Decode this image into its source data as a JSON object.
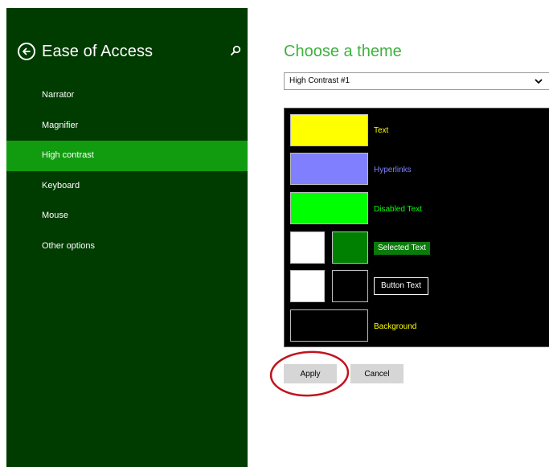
{
  "sidebar": {
    "title": "Ease of Access",
    "back_icon": "back-arrow-icon",
    "search_icon": "search-icon",
    "items": [
      {
        "label": "Narrator"
      },
      {
        "label": "Magnifier"
      },
      {
        "label": "High contrast",
        "selected": true
      },
      {
        "label": "Keyboard"
      },
      {
        "label": "Mouse"
      },
      {
        "label": "Other options"
      }
    ]
  },
  "main": {
    "title": "Choose a theme",
    "theme_select": {
      "value": "High Contrast #1"
    },
    "preview": {
      "text_label": "Text",
      "hyperlinks_label": "Hyperlinks",
      "disabled_text_label": "Disabled Text",
      "selected_text_label": "Selected Text",
      "button_text_label": "Button Text",
      "background_label": "Background"
    },
    "apply_label": "Apply",
    "cancel_label": "Cancel"
  },
  "colors": {
    "sidebar_bg": "#003b00",
    "sidebar_selected": "#119c10",
    "accent_title": "#3db23d",
    "text_swatch": "#ffff00",
    "hyperlinks_swatch": "#8080ff",
    "disabled_text_swatch": "#00ff00",
    "selected_text_bg_swatch": "#ffffff",
    "selected_text_fg_swatch": "#008000",
    "button_bg_swatch": "#ffffff",
    "button_fg_swatch": "#000000",
    "background_swatch": "#000000",
    "annotation_circle": "#c0141e"
  }
}
